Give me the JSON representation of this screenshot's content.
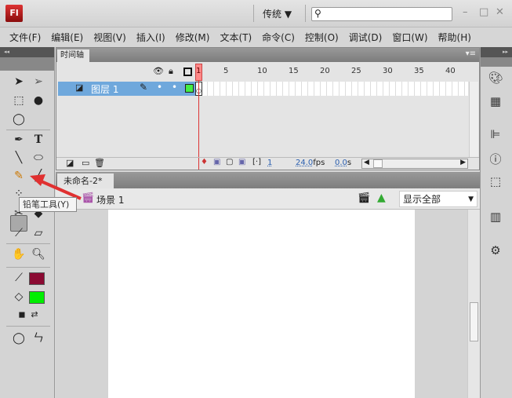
{
  "app": {
    "logo": "Fl",
    "workspace": "传统 ▼",
    "search_placeholder": ""
  },
  "window_buttons": [
    "–",
    "□",
    "✕"
  ],
  "menu": [
    "文件(F)",
    "编辑(E)",
    "视图(V)",
    "插入(I)",
    "修改(M)",
    "文本(T)",
    "命令(C)",
    "控制(O)",
    "调试(D)",
    "窗口(W)",
    "帮助(H)"
  ],
  "toolbox": {
    "collapse": "◂◂",
    "tooltip": "铅笔工具(Y)",
    "stroke_color": "#8b0a32",
    "fill_color": "#00ee00"
  },
  "timeline": {
    "tab": "时间轴",
    "frame_numbers": [
      "1",
      "5",
      "10",
      "15",
      "20",
      "25",
      "30",
      "35",
      "40"
    ],
    "layer_name": "图层 1",
    "current_frame": "1",
    "fps": "24.0",
    "fps_unit": "fps",
    "time": "0.0",
    "time_unit": "s"
  },
  "document": {
    "tab": "未命名-2*",
    "close": "×",
    "scene": "场景 1",
    "zoom": "显示全部"
  },
  "colors": {
    "accent_layer": "#6fa8dc",
    "playhead": "#dd3333",
    "arrow": "#e03030"
  }
}
